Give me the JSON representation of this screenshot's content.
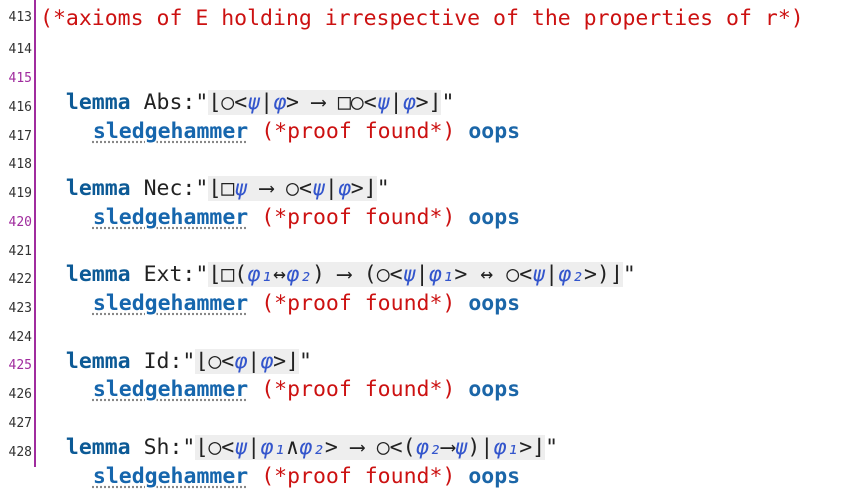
{
  "line_numbers": [
    "413",
    "414",
    "415",
    "416",
    "417",
    "418",
    "419",
    "420",
    "421",
    "422",
    "423",
    "424",
    "425",
    "426",
    "427",
    "428"
  ],
  "header_comment": "(*axioms of E holding irrespective of the properties of r*)",
  "lemmas": [
    {
      "keyword": "lemma",
      "name": "Abs:",
      "open": "\"",
      "term": "⌊○<ψ|φ> ⟶ □○<ψ|φ>⌋",
      "close": "\"",
      "proof_cmd": "sledgehammer",
      "proof_comment": "(*proof found*)",
      "end_cmd": "oops"
    },
    {
      "keyword": "lemma",
      "name": "Nec:",
      "open": "\"",
      "term": "⌊□ψ ⟶ ○<ψ|φ>⌋",
      "close": "\"",
      "proof_cmd": "sledgehammer",
      "proof_comment": "(*proof found*)",
      "end_cmd": "oops"
    },
    {
      "keyword": "lemma",
      "name": "Ext:",
      "open": "\"",
      "term": "⌊□(φ₁↔φ₂) ⟶ (○<ψ|φ₁> ↔ ○<ψ|φ₂>)⌋",
      "close": "\"",
      "proof_cmd": "sledgehammer",
      "proof_comment": "(*proof found*)",
      "end_cmd": "oops"
    },
    {
      "keyword": "lemma",
      "name": "Id:",
      "open": "\"",
      "term": "⌊○<φ|φ>⌋",
      "close": "\"",
      "proof_cmd": "sledgehammer",
      "proof_comment": "(*proof found*)",
      "end_cmd": "oops"
    },
    {
      "keyword": "lemma",
      "name": "Sh:",
      "open": "\"",
      "term": "⌊○<ψ|φ₁∧φ₂> ⟶ ○<(φ₂⟶ψ)|φ₁>⌋",
      "close": "\"",
      "proof_cmd": "sledgehammer",
      "proof_comment": "(*proof found*)",
      "end_cmd": "oops"
    }
  ],
  "colors": {
    "keyword": "#0c5a96",
    "comment": "#cc1111",
    "gutter_bar": "#a02c9e",
    "term_background": "#eeeeee",
    "greek": "#3355cc"
  }
}
